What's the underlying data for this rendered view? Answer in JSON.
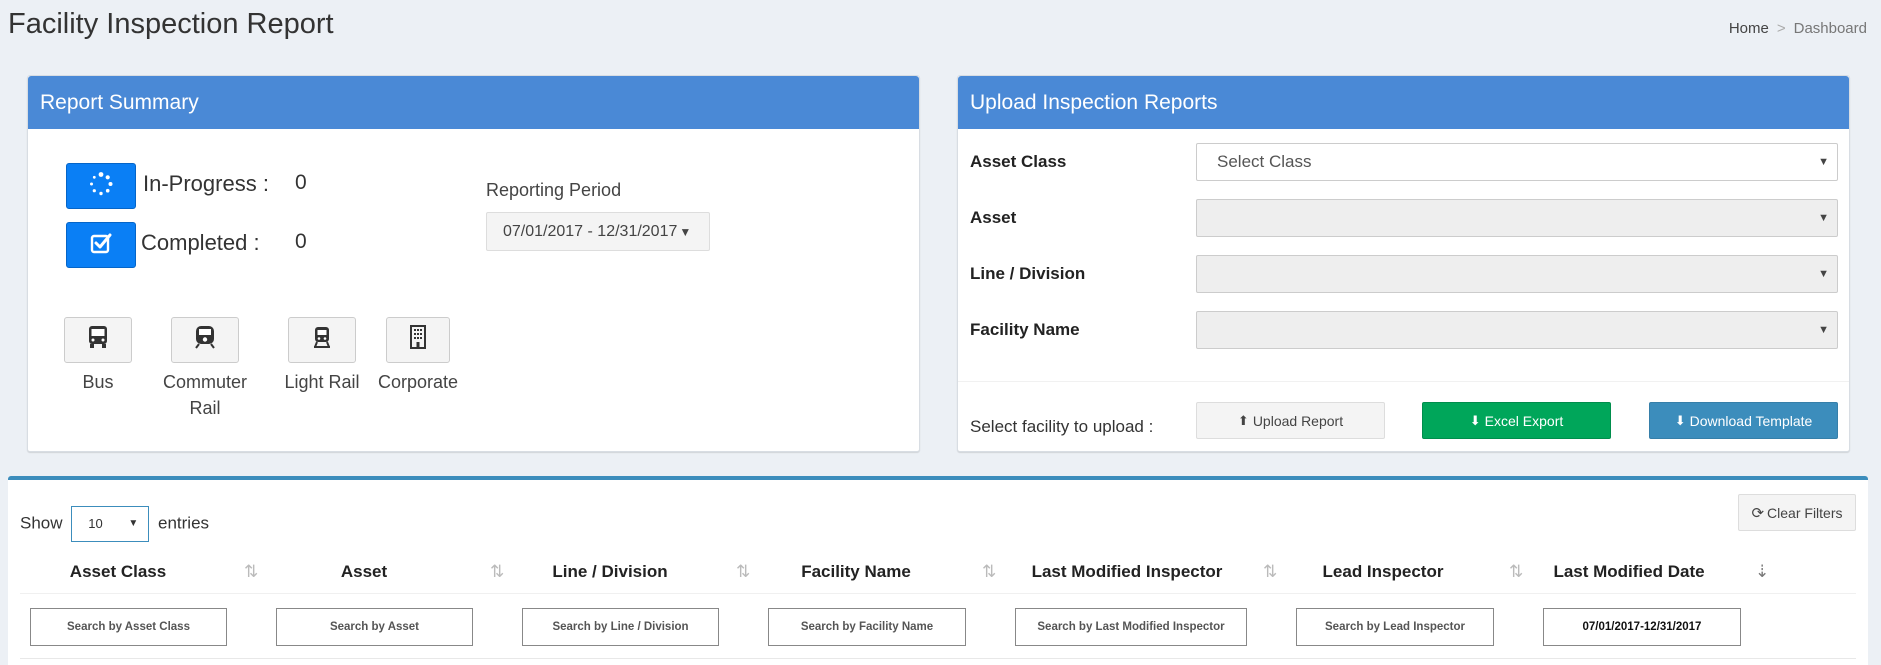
{
  "page": {
    "title": "Facility Inspection Report",
    "breadcrumb": [
      "Home",
      "Dashboard"
    ]
  },
  "summary": {
    "title": "Report Summary",
    "in_progress_label": "In-Progress :",
    "in_progress_value": "0",
    "completed_label": "Completed :",
    "completed_value": "0",
    "period_label": "Reporting Period",
    "period_value": "07/01/2017 - 12/31/2017",
    "asset_types": [
      {
        "label": "Bus",
        "icon": "bus-icon"
      },
      {
        "label": "Commuter Rail",
        "icon": "commuter-rail-icon"
      },
      {
        "label": "Light Rail",
        "icon": "light-rail-icon"
      },
      {
        "label": "Corporate",
        "icon": "building-icon"
      }
    ]
  },
  "upload": {
    "title": "Upload Inspection Reports",
    "fields": [
      {
        "label": "Asset Class",
        "value": "Select Class",
        "disabled": false
      },
      {
        "label": "Asset",
        "value": "",
        "disabled": true
      },
      {
        "label": "Line / Division",
        "value": "",
        "disabled": true
      },
      {
        "label": "Facility Name",
        "value": "",
        "disabled": true
      }
    ],
    "prompt": "Select facility to upload :",
    "upload_button": "Upload Report",
    "excel_button": "Excel Export",
    "template_button": "Download Template",
    "colors": {
      "success": "#00a65a",
      "primary": "#3c8dbc",
      "header": "#4a89d6",
      "status_button": "#0a7ff5"
    }
  },
  "table": {
    "show_label": "Show",
    "entries_label": "entries",
    "page_length": "10",
    "clear_filters": "Clear Filters",
    "columns": [
      "Asset Class",
      "Asset",
      "Line / Division",
      "Facility Name",
      "Last Modified Inspector",
      "Lead Inspector",
      "Last Modified Date"
    ],
    "filters": [
      "Search by Asset Class",
      "Search by Asset",
      "Search by Line / Division",
      "Search by Facility Name",
      "Search by Last Modified Inspector",
      "Search by Lead Inspector",
      "07/01/2017-12/31/2017"
    ]
  }
}
